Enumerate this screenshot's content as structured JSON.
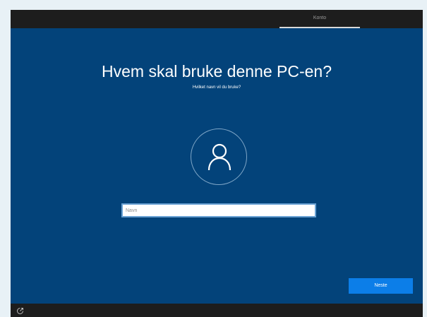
{
  "header": {
    "tab_label": "Konto"
  },
  "main": {
    "title": "Hvem skal bruke denne PC-en?",
    "subtitle": "Hvilket navn vil du bruke?",
    "avatar_icon": "user-icon",
    "name_input": {
      "value": "",
      "placeholder": "Navn"
    },
    "next_button_label": "Neste"
  },
  "footer": {
    "accessibility_icon": "ease-of-access-icon"
  },
  "colors": {
    "background": "#03437a",
    "bar": "#1d1d1d",
    "accent": "#0c7ee8",
    "text": "#ffffff"
  }
}
